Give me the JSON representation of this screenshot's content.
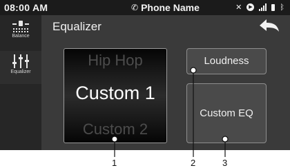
{
  "status_bar": {
    "time": "08:00 AM",
    "device_name": "Phone Name",
    "icons": [
      "phone-icon",
      "mute-icon",
      "bluetooth-audio-icon",
      "signal-icon",
      "battery-icon",
      "bluetooth-icon"
    ]
  },
  "sidebar": {
    "items": [
      {
        "label": "Balance",
        "icon": "balance-icon",
        "active": false
      },
      {
        "label": "Equalizer",
        "icon": "equalizer-icon",
        "active": true
      }
    ]
  },
  "header": {
    "title": "Equalizer",
    "back_icon": "back-arrow-icon"
  },
  "preset_selector": {
    "previous": "Hip Hop",
    "current": "Custom 1",
    "next": "Custom 2"
  },
  "buttons": {
    "loudness": "Loudness",
    "custom_eq": "Custom EQ"
  },
  "callouts": {
    "labels": [
      "1",
      "2",
      "3"
    ]
  },
  "colors": {
    "screen_bg": "#3a3a3a",
    "status_bar_bg": "#1b1b1b",
    "sidebar_bg": "#262626",
    "button_bg": "#4a4a4a",
    "text": "#f2f2f2"
  }
}
